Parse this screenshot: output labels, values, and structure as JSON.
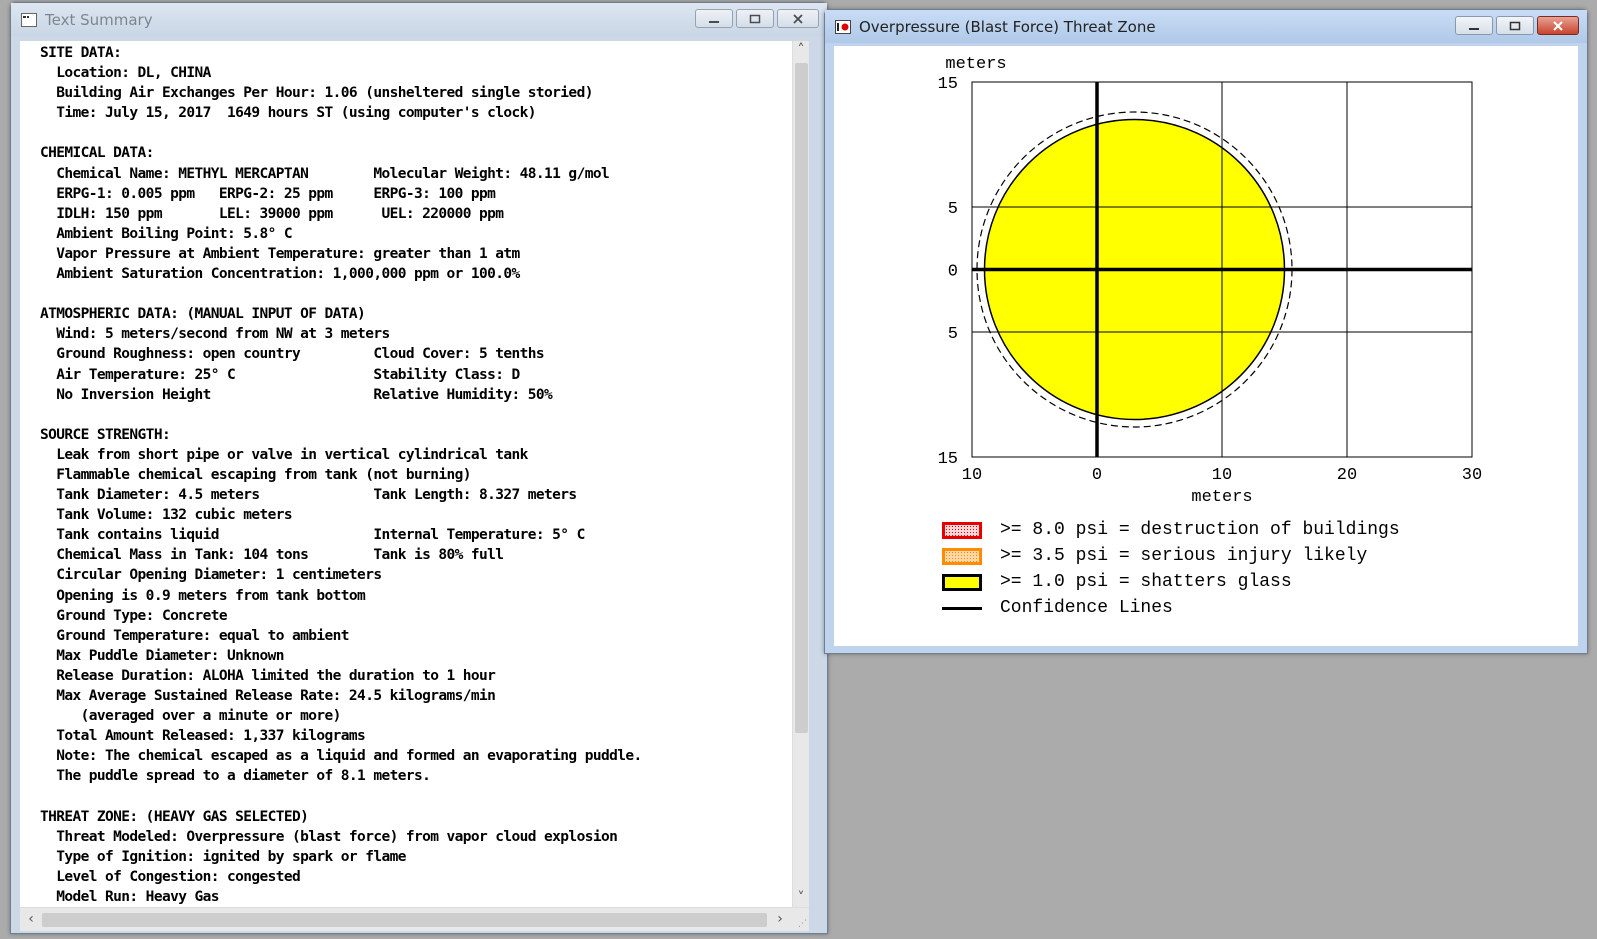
{
  "text_window": {
    "title": "Text Summary",
    "lines": [
      "SITE DATA:",
      "  Location: DL, CHINA",
      "  Building Air Exchanges Per Hour: 1.06 (unsheltered single storied)",
      "  Time: July 15, 2017  1649 hours ST (using computer's clock)",
      "",
      "CHEMICAL DATA:",
      "  Chemical Name: METHYL MERCAPTAN        Molecular Weight: 48.11 g/mol",
      "  ERPG-1: 0.005 ppm   ERPG-2: 25 ppm     ERPG-3: 100 ppm",
      "  IDLH: 150 ppm       LEL: 39000 ppm      UEL: 220000 ppm",
      "  Ambient Boiling Point: 5.8° C",
      "  Vapor Pressure at Ambient Temperature: greater than 1 atm",
      "  Ambient Saturation Concentration: 1,000,000 ppm or 100.0%",
      "",
      "ATMOSPHERIC DATA: (MANUAL INPUT OF DATA)",
      "  Wind: 5 meters/second from NW at 3 meters",
      "  Ground Roughness: open country         Cloud Cover: 5 tenths",
      "  Air Temperature: 25° C                 Stability Class: D",
      "  No Inversion Height                    Relative Humidity: 50%",
      "",
      "SOURCE STRENGTH:",
      "  Leak from short pipe or valve in vertical cylindrical tank",
      "  Flammable chemical escaping from tank (not burning)",
      "  Tank Diameter: 4.5 meters              Tank Length: 8.327 meters",
      "  Tank Volume: 132 cubic meters",
      "  Tank contains liquid                   Internal Temperature: 5° C",
      "  Chemical Mass in Tank: 104 tons        Tank is 80% full",
      "  Circular Opening Diameter: 1 centimeters",
      "  Opening is 0.9 meters from tank bottom",
      "  Ground Type: Concrete",
      "  Ground Temperature: equal to ambient",
      "  Max Puddle Diameter: Unknown",
      "  Release Duration: ALOHA limited the duration to 1 hour",
      "  Max Average Sustained Release Rate: 24.5 kilograms/min",
      "     (averaged over a minute or more)",
      "  Total Amount Released: 1,337 kilograms",
      "  Note: The chemical escaped as a liquid and formed an evaporating puddle.",
      "  The puddle spread to a diameter of 8.1 meters.",
      "",
      "THREAT ZONE: (HEAVY GAS SELECTED)",
      "  Threat Modeled: Overpressure (blast force) from vapor cloud explosion",
      "  Type of Ignition: ignited by spark or flame",
      "  Level of Congestion: congested",
      "  Model Run: Heavy Gas"
    ]
  },
  "chart_window": {
    "title": "Overpressure (Blast Force) Threat Zone"
  },
  "chart_data": {
    "type": "threat-zone-plot",
    "y_unit_label": "meters",
    "x_unit_label": "meters",
    "xlim": [
      -10,
      30
    ],
    "ylim": [
      -15,
      15
    ],
    "x_ticks": [
      -10,
      0,
      10,
      20,
      30
    ],
    "x_tick_labels": [
      "10",
      "0",
      "10",
      "20",
      "30"
    ],
    "y_ticks": [
      15,
      5,
      0,
      -5,
      -15
    ],
    "y_tick_labels": [
      "15",
      "5",
      "0",
      "5",
      "15"
    ],
    "grid": true,
    "zone": {
      "label": ">= 1.0 psi = shatters glass",
      "center_x": 3,
      "center_y": 0,
      "radius": 12,
      "fill": "#ffff00"
    },
    "confidence_line": {
      "center_x": 3,
      "center_y": 0,
      "radius": 12.6
    },
    "legend": [
      {
        "label": ">= 8.0 psi = destruction of buildings",
        "fill": "#ffd9d9",
        "border": "#e60000",
        "kind": "box"
      },
      {
        "label": ">= 3.5 psi = serious injury likely",
        "fill": "#ffd8a8",
        "border": "#ff8c00",
        "kind": "box"
      },
      {
        "label": ">= 1.0 psi = shatters glass",
        "fill": "#ffff00",
        "border": "#000000",
        "kind": "box"
      },
      {
        "label": "Confidence Lines",
        "fill": "",
        "border": "#000000",
        "kind": "line"
      }
    ]
  }
}
